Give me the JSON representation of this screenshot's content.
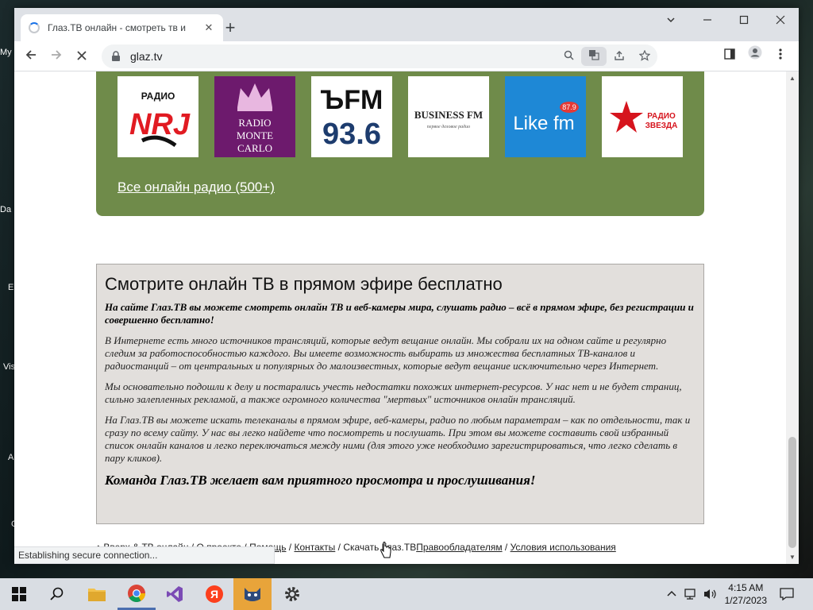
{
  "desktop": {
    "labels": [
      "My",
      "Da",
      "E",
      "Vis",
      "A",
      "C"
    ]
  },
  "browser": {
    "tab_title": "Глаз.ТВ онлайн - смотреть тв и",
    "tab_close": "✕",
    "new_tab": "+",
    "url": "glaz.tv",
    "status_text": "Establishing secure connection..."
  },
  "radio": {
    "logos": [
      {
        "name": "radio-nrj-logo",
        "top": "РАДИО",
        "main": "NRJ",
        "bg": "#ffffff",
        "fg": "#e11b22"
      },
      {
        "name": "radio-monte-carlo-logo",
        "top": "RADIO",
        "main": "MONTE CARLO",
        "bg": "#6d1a6d",
        "fg": "#ffffff"
      },
      {
        "name": "bfm-logo",
        "top": "ЪFM",
        "main": "93.6",
        "bg": "#ffffff",
        "fg": "#1d3c6e"
      },
      {
        "name": "business-fm-logo",
        "top": "BUSINESS FM",
        "main": "первое деловое радио",
        "bg": "#ffffff",
        "fg": "#222222"
      },
      {
        "name": "like-fm-logo",
        "top": "87.9",
        "main": "Like fm",
        "bg": "#1e88d6",
        "fg": "#ffffff"
      },
      {
        "name": "radio-zvezda-logo",
        "top": "★",
        "main": "РАДИО ЗВЕЗДА",
        "bg": "#ffffff",
        "fg": "#d6141d"
      }
    ],
    "all_radio_link": "Все онлайн радио (500+)"
  },
  "info": {
    "heading": "Смотрите онлайн ТВ в прямом эфире бесплатно",
    "lead": "На сайте Глаз.ТВ вы можете смотреть онлайн ТВ и веб-камеры мира, слушать радио – всё в прямом эфире, без регистрации и совершенно бесплатно!",
    "p1": "В Интернете есть много источников трансляций, которые ведут вещание онлайн. Мы собрали их на одном сайте и регулярно следим за работоспособностью каждого. Вы имеете возможность выбирать из множества бесплатных ТВ-каналов и радиостанций – от центральных и популярных до малоизвестных, которые ведут вещание исключительно через Интернет.",
    "p2": "Мы основательно подошли к делу и постарались учесть недостатки похожих интернет-ресурсов. У нас нет и не будет страниц, сильно залепленных рекламой, а также огромного количества \"мертвых\" источников онлайн трансляций.",
    "p3": "На Глаз.ТВ вы можете искать телеканалы в прямом эфире, веб-камеры, радио по любым параметрам – как по отдельности, так и сразу по всему сайту. У нас вы легко найдете что посмотреть и послушать. При этом вы можете составить свой избранный список онлайн каналов и легко переключаться между ними (для этого уже необходимо зарегистрироваться, что легко сделать в пару кликов).",
    "slogan": "Команда Глаз.ТВ желает вам приятного просмотра и прослушивания!"
  },
  "footer": {
    "up": "↑ Вверх",
    "amp": " & ",
    "tv_online": "ТВ онлайн",
    "sep": " / ",
    "about": "О проекте",
    "help": "Помощь",
    "contacts": "Контакты",
    "download": "Скачать Глаз.ТВ",
    "rights": "Правообладателям",
    "terms": "Условия использования"
  },
  "taskbar": {
    "time": "4:15 AM",
    "date": "1/27/2023"
  }
}
